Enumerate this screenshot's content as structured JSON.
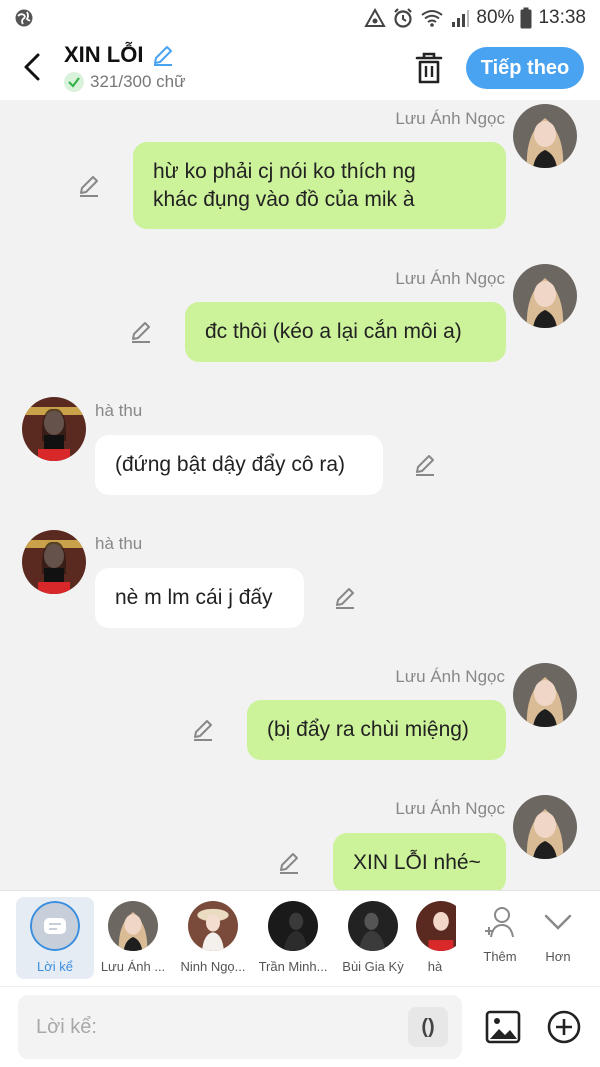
{
  "statusbar": {
    "battery": "80%",
    "time": "13:38"
  },
  "header": {
    "title": "XIN LỖI",
    "word_count": "321/300 chữ",
    "next_label": "Tiếp theo"
  },
  "messages": [
    {
      "side": "right",
      "sender": "Lưu Ánh Ngọc",
      "text": "hừ ko phải cj nói ko thích ng\nkhác đụng vào đồ của mik à"
    },
    {
      "side": "right",
      "sender": "Lưu Ánh Ngọc",
      "text": "đc thôi (kéo a lại cắn môi a)"
    },
    {
      "side": "left",
      "sender": "hà thu",
      "text": "(đứng bật dậy đẩy cô ra)"
    },
    {
      "side": "left",
      "sender": "hà thu",
      "text": "nè m lm cái j đấy"
    },
    {
      "side": "right",
      "sender": "Lưu Ánh Ngọc",
      "text": "(bị đẩy ra chùi miệng)"
    },
    {
      "side": "right",
      "sender": "Lưu Ánh Ngọc",
      "text": "XIN LỖI nhé~"
    }
  ],
  "characters": [
    {
      "label": "Lời kể",
      "selected": true
    },
    {
      "label": "Lưu Ánh ..."
    },
    {
      "label": "Ninh Ngọ..."
    },
    {
      "label": "Trần Minh..."
    },
    {
      "label": "Bùi Gia Kỳ"
    },
    {
      "label": "hà"
    }
  ],
  "actions": {
    "add_label": "Thêm",
    "more_label": "Hơn"
  },
  "input": {
    "placeholder": "Lời kể:",
    "paren_label": "()"
  },
  "colors": {
    "accent": "#4aa3f0",
    "bubble_right": "#ccf29a",
    "bubble_left": "#ffffff",
    "background": "#f2f2f2"
  }
}
